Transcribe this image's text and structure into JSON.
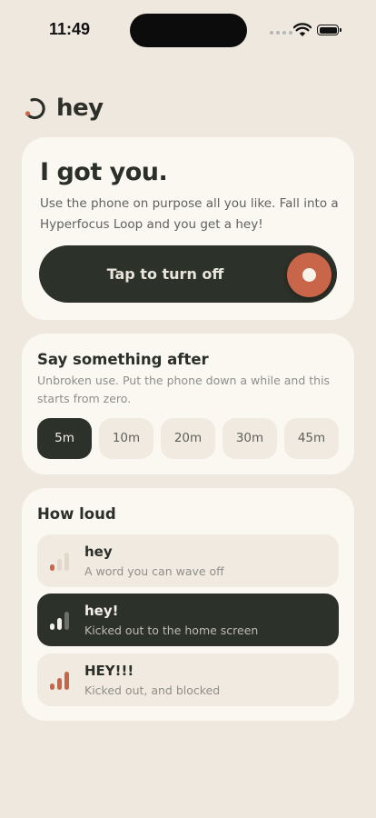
{
  "status_bar": {
    "time": "11:49",
    "icons": [
      "signal-dots-icon",
      "wifi-icon",
      "battery-icon"
    ]
  },
  "brand": {
    "name": "hey",
    "logo_icon": "loop-spinner-icon",
    "accent": "#c9664a"
  },
  "hero": {
    "title": "I got you.",
    "body": "Use the phone on purpose all you like. Fall into a Hyperfocus Loop and you get a hey!",
    "toggle_label": "Tap to turn off",
    "toggle_on": true
  },
  "delay": {
    "title": "Say something after",
    "description": "Unbroken use. Put the phone down a while and this starts from zero.",
    "options": [
      "5m",
      "10m",
      "20m",
      "30m",
      "45m"
    ],
    "selected": "5m"
  },
  "loudness": {
    "title": "How loud",
    "options": [
      {
        "name": "hey",
        "description": "A word you can wave off",
        "level": 1
      },
      {
        "name": "hey!",
        "description": "Kicked out to the home screen",
        "level": 2
      },
      {
        "name": "HEY!!!",
        "description": "Kicked out, and blocked",
        "level": 3
      }
    ],
    "selected": "hey!"
  },
  "colors": {
    "background": "#efe8df",
    "card": "#fbf8f2",
    "dark": "#2c3129",
    "accent": "#c9664a"
  }
}
